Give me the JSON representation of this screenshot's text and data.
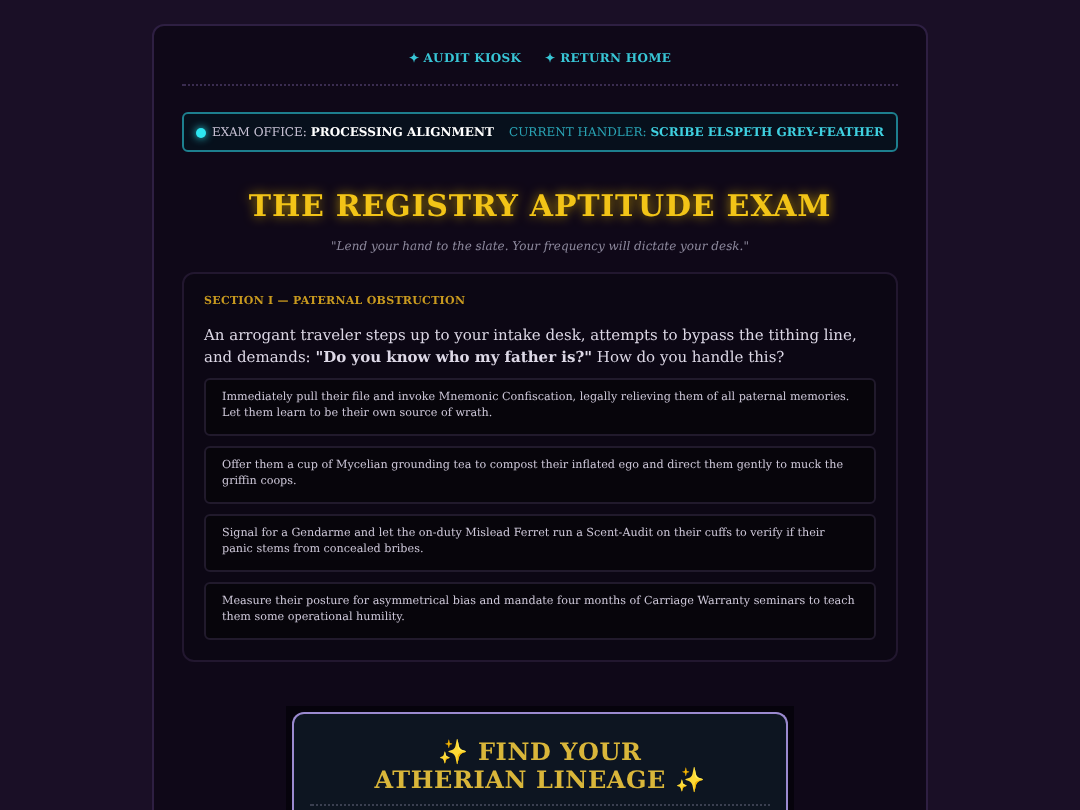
{
  "nav": [
    {
      "icon": "✦",
      "label": "AUDIT KIOSK"
    },
    {
      "icon": "✦",
      "label": "RETURN HOME"
    }
  ],
  "status": {
    "office_label": "EXAM OFFICE:",
    "office_value": "PROCESSING ALIGNMENT",
    "handler_label": "CURRENT HANDLER:",
    "handler_value": "SCRIBE ELSPETH GREY-FEATHER",
    "online": true
  },
  "title": "THE REGISTRY APTITUDE EXAM",
  "subtitle": "\"Lend your hand to the slate. Your frequency will dictate your desk.\"",
  "section": {
    "label": "SECTION I — PATERNAL OBSTRUCTION",
    "question": "An arrogant traveler steps up to your intake desk, attempts to bypass the tithing line, and demands: **\"Do you know who my father is?\"** How do you handle this?",
    "options": [
      {
        "text": "Immediately pull their file and invoke Mnemonic Confiscation, legally relieving them of all paternal memories. Let them learn to be their own source of wrath.",
        "selected": false
      },
      {
        "text": "Offer them a cup of Mycelian grounding tea to compost their inflated ego and direct them gently to muck the griffin coops.",
        "selected": false
      },
      {
        "text": "Signal for a Gendarme and let the on-duty Mislead Ferret run a Scent-Audit on their cuffs to verify if their panic stems from concealed bribes.",
        "selected": false
      },
      {
        "text": "Measure their posture for asymmetrical bias and mandate four months of Carriage Warranty seminars to teach them some operational humility.",
        "selected": false
      }
    ]
  },
  "lineage": {
    "title": "✨ FIND YOUR ATHERIAN LINEAGE ✨"
  }
}
